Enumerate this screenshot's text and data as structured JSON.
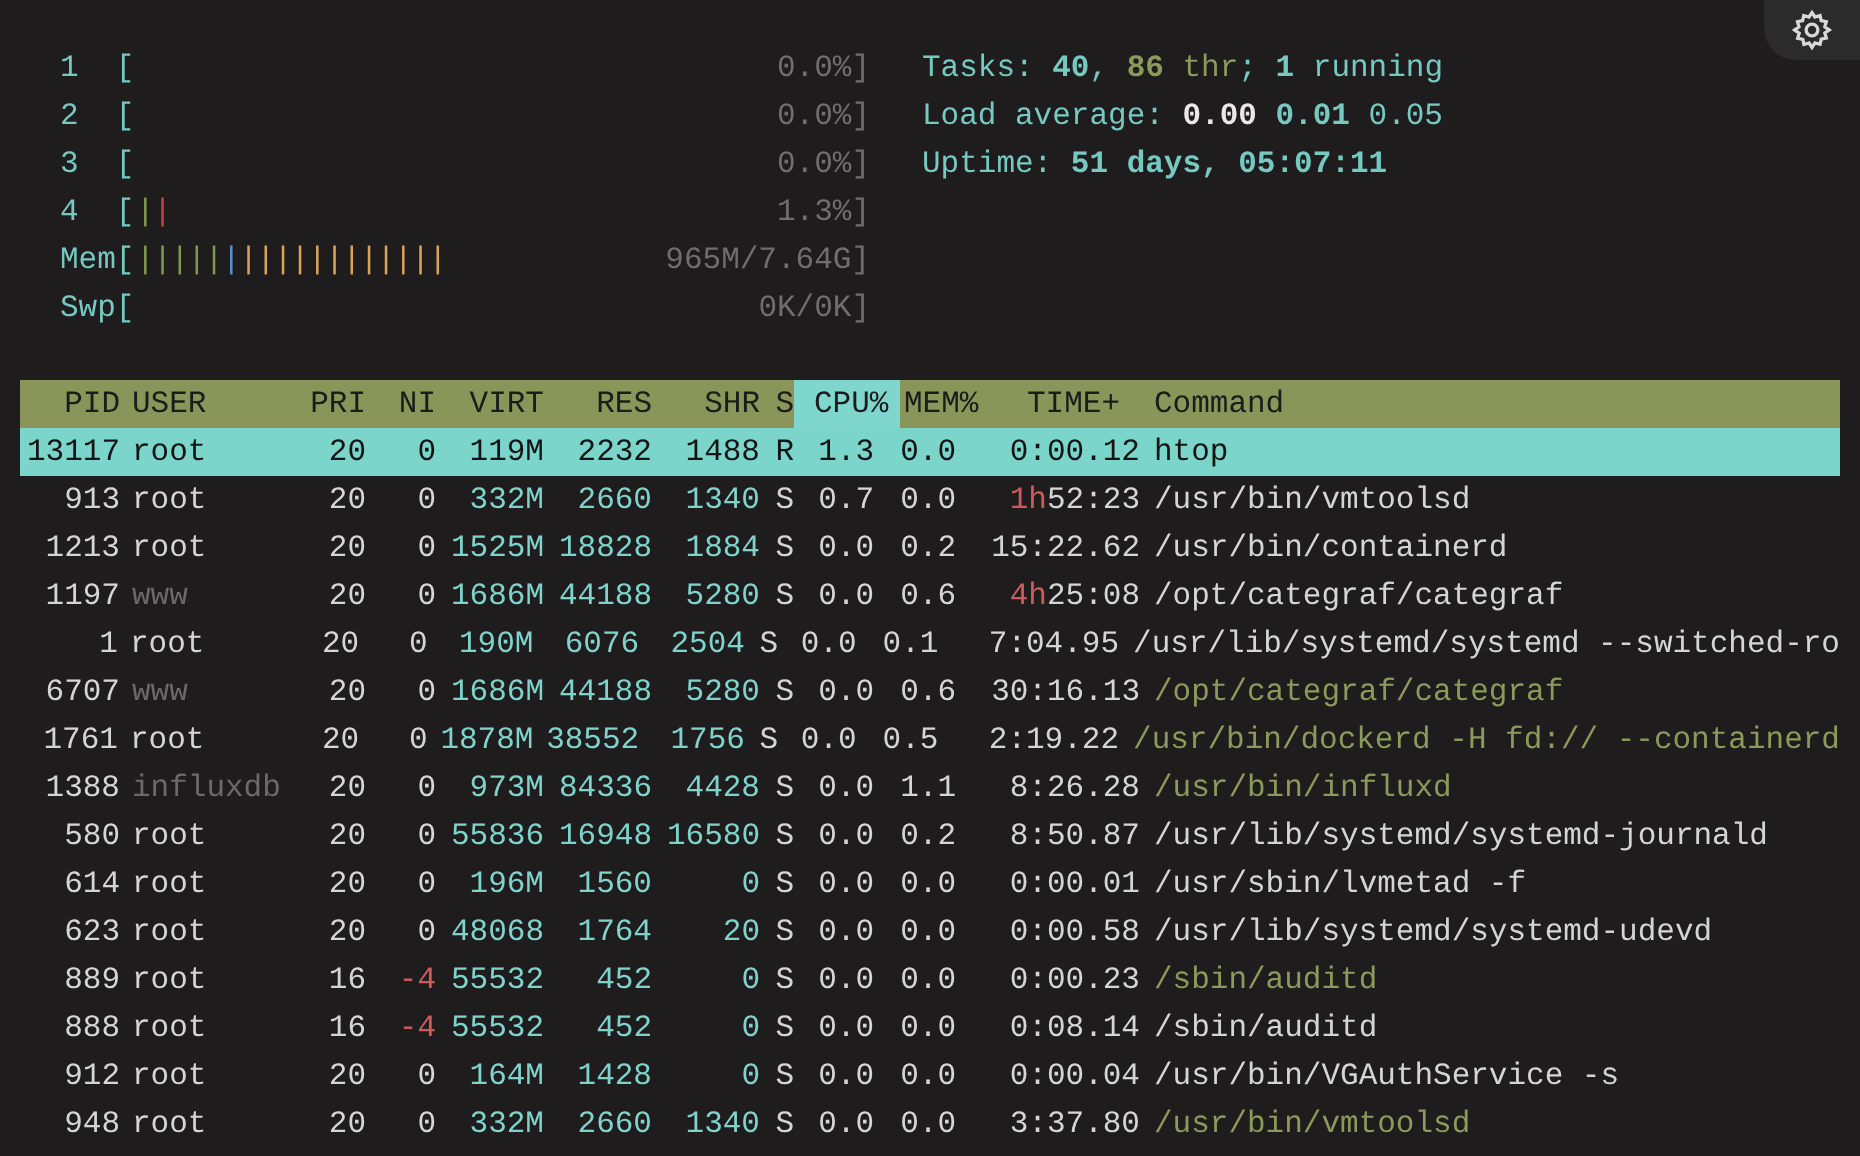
{
  "meters": [
    {
      "label": "1  [",
      "reading": "0.0%]"
    },
    {
      "label": "2  [",
      "reading": "0.0%]"
    },
    {
      "label": "3  [",
      "reading": "0.0%]"
    },
    {
      "label": "4  [",
      "reading": "1.3%]",
      "segments": [
        {
          "color": "#7e9a4e",
          "text": "|"
        },
        {
          "color": "#c0463f",
          "text": "|"
        }
      ]
    },
    {
      "label": "Mem[",
      "reading": "965M/7.64G]",
      "segments": [
        {
          "color": "#7e9a4e",
          "text": "|||||"
        },
        {
          "color": "#5b8fc7",
          "text": "|"
        },
        {
          "color": "#d9a35a",
          "text": "||||||||||||"
        }
      ]
    },
    {
      "label": "Swp[",
      "reading": "0K/0K]"
    }
  ],
  "summary": [
    [
      {
        "text": "Tasks: ",
        "color": "#76c9c1",
        "bold": false
      },
      {
        "text": "40",
        "color": "#76c9c1",
        "bold": true
      },
      {
        "text": ", ",
        "color": "#76c9c1",
        "bold": false
      },
      {
        "text": "86",
        "color": "#8a9a5b",
        "bold": true
      },
      {
        "text": " thr",
        "color": "#8a9a5b",
        "bold": false
      },
      {
        "text": "; ",
        "color": "#76c9c1",
        "bold": false
      },
      {
        "text": "1",
        "color": "#76c9c1",
        "bold": true
      },
      {
        "text": " running",
        "color": "#76c9c1",
        "bold": false
      }
    ],
    [
      {
        "text": "Load average: ",
        "color": "#76c9c1",
        "bold": false
      },
      {
        "text": "0.00",
        "color": "#e8e8e8",
        "bold": true
      },
      {
        "text": " 0.01",
        "color": "#76c9c1",
        "bold": true
      },
      {
        "text": " 0.05",
        "color": "#76c9c1",
        "bold": false
      }
    ],
    [
      {
        "text": "Uptime: ",
        "color": "#76c9c1",
        "bold": false
      },
      {
        "text": "51 days, 05:07:11",
        "color": "#76c9c1",
        "bold": true
      }
    ]
  ],
  "columns": [
    {
      "label": "PID",
      "selected": false
    },
    {
      "label": "USER",
      "selected": false
    },
    {
      "label": "PRI",
      "selected": false
    },
    {
      "label": "NI",
      "selected": false
    },
    {
      "label": "VIRT",
      "selected": false
    },
    {
      "label": "RES",
      "selected": false
    },
    {
      "label": "SHR",
      "selected": false
    },
    {
      "label": "S",
      "selected": false
    },
    {
      "label": "CPU%",
      "selected": true
    },
    {
      "label": "MEM%",
      "selected": false
    },
    {
      "label": "TIME+",
      "selected": false
    },
    {
      "label": "Command",
      "selected": false
    }
  ],
  "rows": [
    {
      "pid": "13117",
      "user": "root",
      "pri": "20",
      "ni": "0",
      "virt": "119M",
      "res": "2232",
      "shr": "1488",
      "s": "R",
      "cpu": "1.3",
      "mem": "0.0",
      "time": "0:00.12",
      "command": "htop",
      "selected": true,
      "user_dim": false,
      "ni_negative": false,
      "kind": "process"
    },
    {
      "pid": "913",
      "user": "root",
      "pri": "20",
      "ni": "0",
      "virt": "332M",
      "res": "2660",
      "shr": "1340",
      "s": "S",
      "cpu": "0.7",
      "mem": "0.0",
      "time_hours": "1h",
      "time": "52:23",
      "command": "/usr/bin/vmtoolsd",
      "selected": false,
      "user_dim": false,
      "ni_negative": false,
      "kind": "process"
    },
    {
      "pid": "1213",
      "user": "root",
      "pri": "20",
      "ni": "0",
      "virt": "1525M",
      "res": "18828",
      "shr": "1884",
      "s": "S",
      "cpu": "0.0",
      "mem": "0.2",
      "time": "15:22.62",
      "command": "/usr/bin/containerd",
      "selected": false,
      "user_dim": false,
      "ni_negative": false,
      "kind": "process"
    },
    {
      "pid": "1197",
      "user": "www",
      "pri": "20",
      "ni": "0",
      "virt": "1686M",
      "res": "44188",
      "shr": "5280",
      "s": "S",
      "cpu": "0.0",
      "mem": "0.6",
      "time_hours": "4h",
      "time": "25:08",
      "command": "/opt/categraf/categraf",
      "selected": false,
      "user_dim": true,
      "ni_negative": false,
      "kind": "process"
    },
    {
      "pid": "1",
      "user": "root",
      "pri": "20",
      "ni": "0",
      "virt": "190M",
      "res": "6076",
      "shr": "2504",
      "s": "S",
      "cpu": "0.0",
      "mem": "0.1",
      "time": "7:04.95",
      "command": "/usr/lib/systemd/systemd --switched-ro",
      "selected": false,
      "user_dim": false,
      "ni_negative": false,
      "kind": "process"
    },
    {
      "pid": "6707",
      "user": "www",
      "pri": "20",
      "ni": "0",
      "virt": "1686M",
      "res": "44188",
      "shr": "5280",
      "s": "S",
      "cpu": "0.0",
      "mem": "0.6",
      "time": "30:16.13",
      "command": "/opt/categraf/categraf",
      "selected": false,
      "user_dim": true,
      "ni_negative": false,
      "kind": "thread"
    },
    {
      "pid": "1761",
      "user": "root",
      "pri": "20",
      "ni": "0",
      "virt": "1878M",
      "res": "38552",
      "shr": "1756",
      "s": "S",
      "cpu": "0.0",
      "mem": "0.5",
      "time": "2:19.22",
      "command": "/usr/bin/dockerd -H fd:// --containerd",
      "selected": false,
      "user_dim": false,
      "ni_negative": false,
      "kind": "thread"
    },
    {
      "pid": "1388",
      "user": "influxdb",
      "pri": "20",
      "ni": "0",
      "virt": "973M",
      "res": "84336",
      "shr": "4428",
      "s": "S",
      "cpu": "0.0",
      "mem": "1.1",
      "time": "8:26.28",
      "command": "/usr/bin/influxd",
      "selected": false,
      "user_dim": true,
      "ni_negative": false,
      "kind": "thread"
    },
    {
      "pid": "580",
      "user": "root",
      "pri": "20",
      "ni": "0",
      "virt": "55836",
      "res": "16948",
      "shr": "16580",
      "s": "S",
      "cpu": "0.0",
      "mem": "0.2",
      "time": "8:50.87",
      "command": "/usr/lib/systemd/systemd-journald",
      "selected": false,
      "user_dim": false,
      "ni_negative": false,
      "kind": "process"
    },
    {
      "pid": "614",
      "user": "root",
      "pri": "20",
      "ni": "0",
      "virt": "196M",
      "res": "1560",
      "shr": "0",
      "s": "S",
      "cpu": "0.0",
      "mem": "0.0",
      "time": "0:00.01",
      "command": "/usr/sbin/lvmetad -f",
      "selected": false,
      "user_dim": false,
      "ni_negative": false,
      "kind": "process"
    },
    {
      "pid": "623",
      "user": "root",
      "pri": "20",
      "ni": "0",
      "virt": "48068",
      "res": "1764",
      "shr": "20",
      "s": "S",
      "cpu": "0.0",
      "mem": "0.0",
      "time": "0:00.58",
      "command": "/usr/lib/systemd/systemd-udevd",
      "selected": false,
      "user_dim": false,
      "ni_negative": false,
      "kind": "process"
    },
    {
      "pid": "889",
      "user": "root",
      "pri": "16",
      "ni": "-4",
      "virt": "55532",
      "res": "452",
      "shr": "0",
      "s": "S",
      "cpu": "0.0",
      "mem": "0.0",
      "time": "0:00.23",
      "command": "/sbin/auditd",
      "selected": false,
      "user_dim": false,
      "ni_negative": true,
      "kind": "thread"
    },
    {
      "pid": "888",
      "user": "root",
      "pri": "16",
      "ni": "-4",
      "virt": "55532",
      "res": "452",
      "shr": "0",
      "s": "S",
      "cpu": "0.0",
      "mem": "0.0",
      "time": "0:08.14",
      "command": "/sbin/auditd",
      "selected": false,
      "user_dim": false,
      "ni_negative": true,
      "kind": "process"
    },
    {
      "pid": "912",
      "user": "root",
      "pri": "20",
      "ni": "0",
      "virt": "164M",
      "res": "1428",
      "shr": "0",
      "s": "S",
      "cpu": "0.0",
      "mem": "0.0",
      "time": "0:00.04",
      "command": "/usr/bin/VGAuthService -s",
      "selected": false,
      "user_dim": false,
      "ni_negative": false,
      "kind": "process"
    },
    {
      "pid": "948",
      "user": "root",
      "pri": "20",
      "ni": "0",
      "virt": "332M",
      "res": "2660",
      "shr": "1340",
      "s": "S",
      "cpu": "0.0",
      "mem": "0.0",
      "time": "3:37.80",
      "command": "/usr/bin/vmtoolsd",
      "selected": false,
      "user_dim": false,
      "ni_negative": false,
      "kind": "thread"
    }
  ]
}
